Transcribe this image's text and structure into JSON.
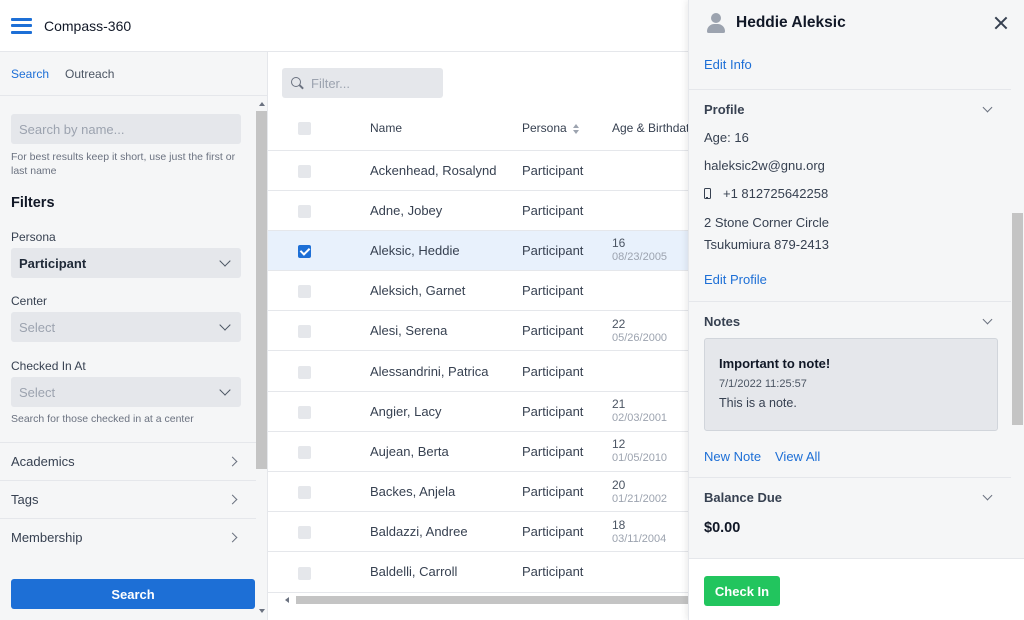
{
  "app": {
    "title": "Compass-360"
  },
  "sidebar": {
    "tabs": [
      {
        "label": "Search",
        "active": true
      },
      {
        "label": "Outreach",
        "active": false
      }
    ],
    "search": {
      "placeholder": "Search by name...",
      "hint": "For best results keep it short, use just the first or last name"
    },
    "filters_title": "Filters",
    "filters": {
      "persona": {
        "label": "Persona",
        "value": "Participant"
      },
      "center": {
        "label": "Center",
        "placeholder": "Select"
      },
      "checked_in_at": {
        "label": "Checked In At",
        "placeholder": "Select",
        "hint": "Search for those checked in at a center"
      }
    },
    "sections": [
      "Academics",
      "Tags",
      "Membership"
    ],
    "search_button": "Search"
  },
  "table": {
    "filter_placeholder": "Filter...",
    "columns": [
      "Name",
      "Persona",
      "Age & Birthdate"
    ],
    "rows": [
      {
        "name": "Ackenhead, Rosalynd",
        "persona": "Participant",
        "age": "",
        "birthdate": "",
        "checked": false
      },
      {
        "name": "Adne, Jobey",
        "persona": "Participant",
        "age": "",
        "birthdate": "",
        "checked": false
      },
      {
        "name": "Aleksic, Heddie",
        "persona": "Participant",
        "age": "16",
        "birthdate": "08/23/2005",
        "checked": true
      },
      {
        "name": "Aleksich, Garnet",
        "persona": "Participant",
        "age": "",
        "birthdate": "",
        "checked": false
      },
      {
        "name": "Alesi, Serena",
        "persona": "Participant",
        "age": "22",
        "birthdate": "05/26/2000",
        "checked": false
      },
      {
        "name": "Alessandrini, Patrica",
        "persona": "Participant",
        "age": "",
        "birthdate": "",
        "checked": false
      },
      {
        "name": "Angier, Lacy",
        "persona": "Participant",
        "age": "21",
        "birthdate": "02/03/2001",
        "checked": false
      },
      {
        "name": "Aujean, Berta",
        "persona": "Participant",
        "age": "12",
        "birthdate": "01/05/2010",
        "checked": false
      },
      {
        "name": "Backes, Anjela",
        "persona": "Participant",
        "age": "20",
        "birthdate": "01/21/2002",
        "checked": false
      },
      {
        "name": "Baldazzi, Andree",
        "persona": "Participant",
        "age": "18",
        "birthdate": "03/11/2004",
        "checked": false
      },
      {
        "name": "Baldelli, Carroll",
        "persona": "Participant",
        "age": "",
        "birthdate": "",
        "checked": false
      }
    ]
  },
  "panel": {
    "name": "Heddie Aleksic",
    "edit_info": "Edit Info",
    "profile": {
      "title": "Profile",
      "age": "Age: 16",
      "email": "haleksic2w@gnu.org",
      "phone": "+1 812725642258",
      "address_line1": "2 Stone Corner Circle",
      "address_line2": "Tsukumiura 879-2413",
      "edit_profile": "Edit Profile"
    },
    "notes": {
      "title": "Notes",
      "note_title": "Important to note!",
      "note_date": "7/1/2022 11:25:57",
      "note_body": "This is a note.",
      "new_note": "New Note",
      "view_all": "View All"
    },
    "balance": {
      "title": "Balance Due",
      "amount": "$0.00"
    },
    "check_in": "Check In"
  },
  "colors": {
    "accent": "#1d6fd6",
    "success": "#22c55e",
    "selected_row": "#e8f1fc"
  }
}
